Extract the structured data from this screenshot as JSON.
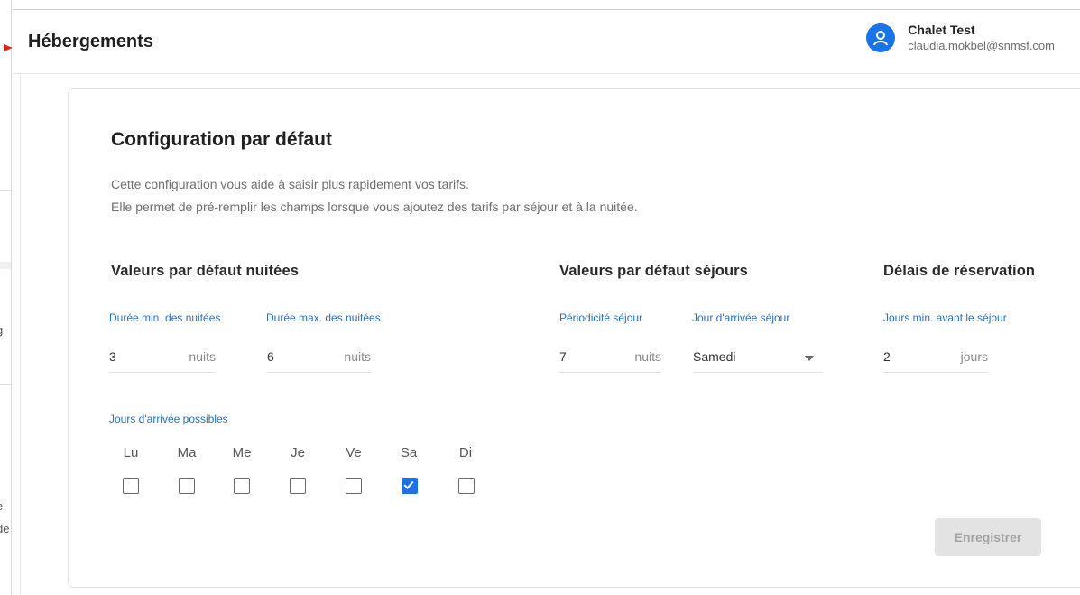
{
  "header": {
    "title": "Hébergements",
    "user_name": "Chalet Test",
    "user_email": "claudia.mokbel@snmsf.com"
  },
  "left_strip": {
    "fragment_1": "g",
    "fragment_2": "e",
    "fragment_3": "de"
  },
  "card": {
    "title": "Configuration par défaut",
    "description_1": "Cette configuration vous aide à saisir plus rapidement vos tarifs.",
    "description_2": "Elle permet de pré-remplir les champs lorsque vous ajoutez des tarifs par séjour et à la nuitée."
  },
  "nuitees": {
    "title": "Valeurs par défaut nuitées",
    "min_label": "Durée min. des nuitées",
    "min_value": "3",
    "min_unit": "nuits",
    "max_label": "Durée max. des nuitées",
    "max_value": "6",
    "max_unit": "nuits"
  },
  "sejours": {
    "title": "Valeurs par défaut séjours",
    "period_label": "Périodicité séjour",
    "period_value": "7",
    "period_unit": "nuits",
    "arrival_label": "Jour d'arrivée séjour",
    "arrival_value": "Samedi"
  },
  "delais": {
    "title": "Délais de réservation",
    "min_label": "Jours min. avant le séjour",
    "min_value": "2",
    "min_unit": "jours"
  },
  "arrival_days": {
    "label": "Jours d'arrivée possibles",
    "days": [
      {
        "label": "Lu",
        "checked": false
      },
      {
        "label": "Ma",
        "checked": false
      },
      {
        "label": "Me",
        "checked": false
      },
      {
        "label": "Je",
        "checked": false
      },
      {
        "label": "Ve",
        "checked": false
      },
      {
        "label": "Sa",
        "checked": true
      },
      {
        "label": "Di",
        "checked": false
      }
    ]
  },
  "save_label": "Enregistrer",
  "colors": {
    "accent": "#1a73e8",
    "label_blue": "#2b6fb6",
    "arrow_red": "#d9261c"
  }
}
